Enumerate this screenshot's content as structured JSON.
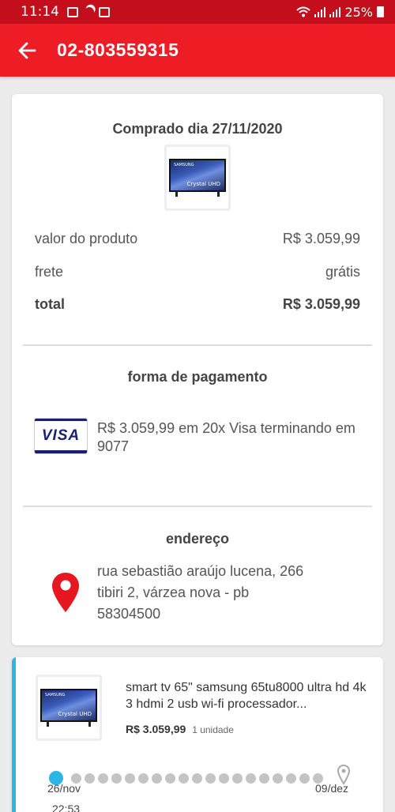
{
  "status_bar": {
    "time": "11:14",
    "battery": "25%"
  },
  "header": {
    "title": "02-803559315"
  },
  "purchase": {
    "title": "Comprado dia 27/11/2020",
    "product_label_text": "Crystal UHD",
    "product_brand_text": "SAMSUNG",
    "rows": [
      {
        "label": "valor do produto",
        "value": "R$ 3.059,99"
      },
      {
        "label": "frete",
        "value": "grátis"
      },
      {
        "label": "total",
        "value": "R$ 3.059,99"
      }
    ]
  },
  "payment": {
    "title": "forma de pagamento",
    "card_brand": "VISA",
    "description": "R$ 3.059,99 em 20x Visa terminando em 9077"
  },
  "address": {
    "title": "endereço",
    "line1": "rua sebastião araújo lucena, 266",
    "line2": "tibiri 2, várzea nova - pb",
    "line3": "58304500"
  },
  "order": {
    "product_name": "smart tv 65\" samsung 65tu8000 ultra hd 4k 3 hdmi 2 usb wi-fi processador...",
    "price": "R$ 3.059,99",
    "quantity": "1 unidade",
    "timeline": {
      "start_date": "26/nov",
      "start_time": "22:53",
      "end_date": "09/dez"
    }
  },
  "colors": {
    "header_red": "#ee1c25",
    "status_red": "#c40e1c",
    "accent_blue": "#2bb6e6",
    "pin_red": "#e8161f"
  }
}
